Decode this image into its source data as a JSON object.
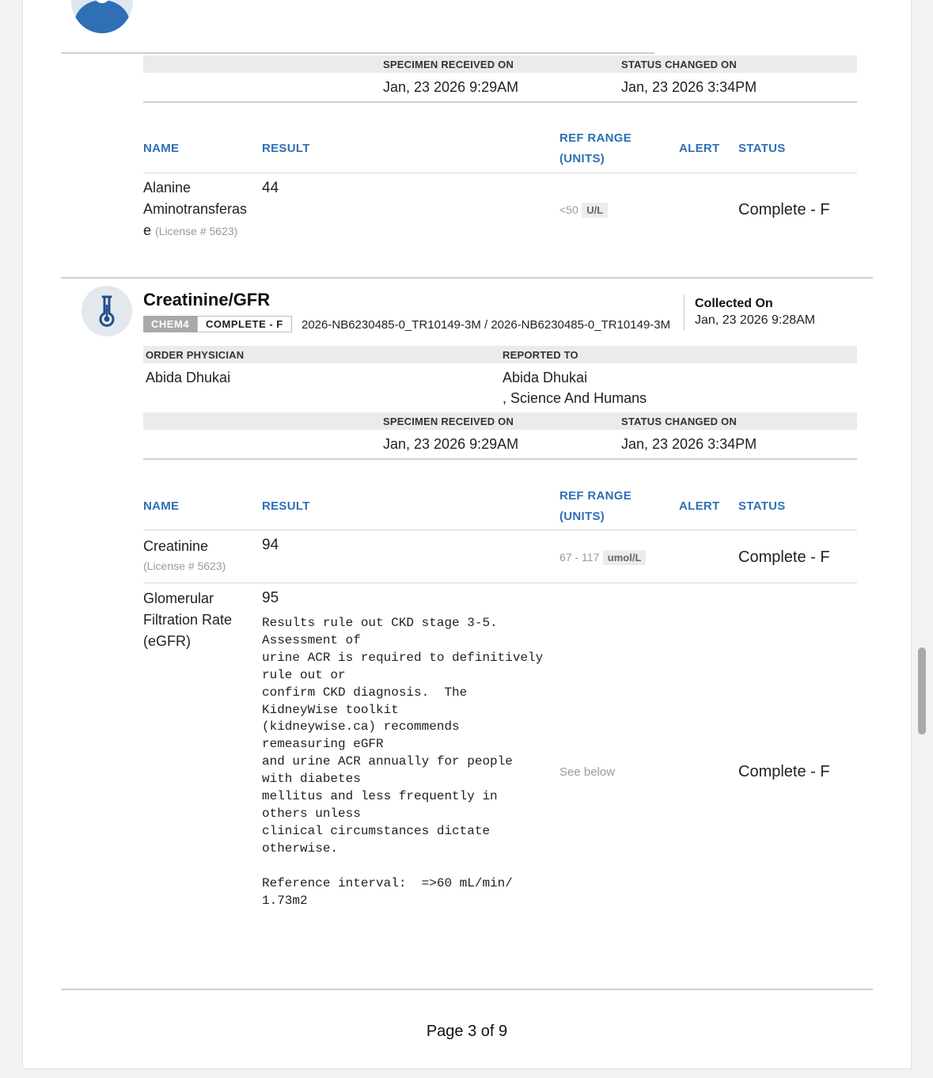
{
  "top_section": {
    "specimen_received_label": "SPECIMEN RECEIVED ON",
    "specimen_received_value": "Jan, 23 2026 9:29AM",
    "status_changed_label": "STATUS CHANGED ON",
    "status_changed_value": "Jan, 23 2026 3:34PM",
    "columns": {
      "name": "NAME",
      "result": "RESULT",
      "ref_range_1": "REF RANGE",
      "ref_range_2": "(UNITS)",
      "alert": "ALERT",
      "status": "STATUS"
    },
    "rows": [
      {
        "name_line1": "Alanine",
        "name_line2": "Aminotransferas",
        "name_line3": "e",
        "license": "(License # 5623)",
        "result": "44",
        "ref": "<50",
        "unit": "U/L",
        "status": "Complete - F"
      }
    ]
  },
  "test": {
    "icon": "thermometer-icon",
    "title": "Creatinine/GFR",
    "code": "CHEM4",
    "status_chip": "COMPLETE - F",
    "accession": "2026-NB6230485-0_TR10149-3M / 2026-NB6230485-0_TR10149-3M",
    "collected_label": "Collected On",
    "collected_value": "Jan, 23 2026 9:28AM",
    "order_physician_label": "ORDER PHYSICIAN",
    "order_physician_value": "Abida Dhukai",
    "reported_to_label": "REPORTED TO",
    "reported_to_line1": "Abida Dhukai",
    "reported_to_line2": ", Science And Humans",
    "specimen_received_label": "SPECIMEN RECEIVED ON",
    "specimen_received_value": "Jan, 23 2026 9:29AM",
    "status_changed_label": "STATUS CHANGED ON",
    "status_changed_value": "Jan, 23 2026 3:34PM",
    "columns": {
      "name": "NAME",
      "result": "RESULT",
      "ref_range_1": "REF RANGE",
      "ref_range_2": "(UNITS)",
      "alert": "ALERT",
      "status": "STATUS"
    },
    "rows": [
      {
        "name": "Creatinine",
        "license": "(License # 5623)",
        "result": "94",
        "ref": "67 - 117",
        "unit": "umol/L",
        "status": "Complete - F"
      },
      {
        "name_line1": "Glomerular",
        "name_line2": "Filtration Rate",
        "name_line3": "(eGFR)",
        "result": "95",
        "comment": "Results rule out CKD stage 3-5.\nAssessment of\nurine ACR is required to definitively\nrule out or\nconfirm CKD diagnosis.  The\nKidneyWise toolkit\n(kidneywise.ca) recommends\nremeasuring eGFR\nand urine ACR annually for people\nwith diabetes\nmellitus and less frequently in\nothers unless\nclinical circumstances dictate\notherwise.\n\nReference interval:  =>60 mL/min/\n1.73m2",
        "ref": "See below",
        "status": "Complete - F"
      }
    ]
  },
  "footer": {
    "page_label": "Page 3 of 9"
  },
  "colors": {
    "accent": "#2f70b4",
    "header_bg": "#ebebeb"
  }
}
